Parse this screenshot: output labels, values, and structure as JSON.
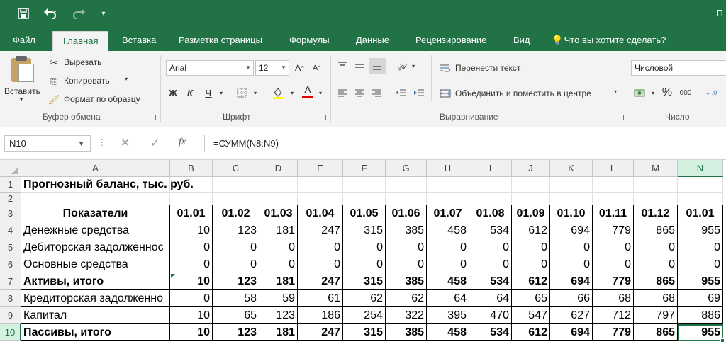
{
  "window": {
    "title_fragment": "П",
    "accent": "#217346"
  },
  "qat": {
    "save_icon": "save-icon",
    "undo_icon": "undo-icon",
    "redo_icon": "redo-icon",
    "customize_icon": "customize-qat-icon"
  },
  "tabs": [
    {
      "label": "Файл",
      "active": false
    },
    {
      "label": "Главная",
      "active": true
    },
    {
      "label": "Вставка",
      "active": false
    },
    {
      "label": "Разметка страницы",
      "active": false
    },
    {
      "label": "Формулы",
      "active": false
    },
    {
      "label": "Данные",
      "active": false
    },
    {
      "label": "Рецензирование",
      "active": false
    },
    {
      "label": "Вид",
      "active": false
    }
  ],
  "tell_me": {
    "label": "Что вы хотите сделать?",
    "icon": "lightbulb-icon"
  },
  "ribbon": {
    "clipboard": {
      "paste_label": "Вставить",
      "cut_label": "Вырезать",
      "copy_label": "Копировать",
      "format_painter_label": "Формат по образцу",
      "group_label": "Буфер обмена"
    },
    "font": {
      "font_name": "Arial",
      "font_size": "12",
      "bold": "Ж",
      "italic": "К",
      "underline": "Ч",
      "group_label": "Шрифт"
    },
    "alignment": {
      "wrap_text_label": "Перенести текст",
      "merge_label": "Объединить и поместить в центре",
      "group_label": "Выравнивание"
    },
    "number": {
      "format_value": "Числовой",
      "percent": "%",
      "thousands": "000",
      "group_label": "Число"
    }
  },
  "formula_bar": {
    "name_box": "N10",
    "formula": "=СУММ(N8:N9)",
    "fx": "fx",
    "cancel": "✕",
    "enter": "✓"
  },
  "sheet": {
    "columns": [
      "A",
      "B",
      "C",
      "D",
      "E",
      "F",
      "G",
      "H",
      "I",
      "J",
      "K",
      "L",
      "M",
      "N"
    ],
    "selected_column": "N",
    "selected_row": "10",
    "title": "Прогнозный баланс, тыс. руб.",
    "header_label": "Показатели",
    "dates": [
      "01.01",
      "01.02",
      "01.03",
      "01.04",
      "01.05",
      "01.06",
      "01.07",
      "01.08",
      "01.09",
      "01.10",
      "01.11",
      "01.12",
      "01.01"
    ],
    "rows": [
      {
        "num": "4",
        "label": "Денежные средства",
        "bold": false,
        "values": [
          "10",
          "123",
          "181",
          "247",
          "315",
          "385",
          "458",
          "534",
          "612",
          "694",
          "779",
          "865",
          "955"
        ]
      },
      {
        "num": "5",
        "label": "Дебиторская задолженнос",
        "bold": false,
        "values": [
          "0",
          "0",
          "0",
          "0",
          "0",
          "0",
          "0",
          "0",
          "0",
          "0",
          "0",
          "0",
          "0"
        ]
      },
      {
        "num": "6",
        "label": "Основные средства",
        "bold": false,
        "values": [
          "0",
          "0",
          "0",
          "0",
          "0",
          "0",
          "0",
          "0",
          "0",
          "0",
          "0",
          "0",
          "0"
        ]
      },
      {
        "num": "7",
        "label": "Активы, итого",
        "bold": true,
        "values": [
          "10",
          "123",
          "181",
          "247",
          "315",
          "385",
          "458",
          "534",
          "612",
          "694",
          "779",
          "865",
          "955"
        ]
      },
      {
        "num": "8",
        "label": "Кредиторская задолженно",
        "bold": false,
        "values": [
          "0",
          "58",
          "59",
          "61",
          "62",
          "62",
          "64",
          "64",
          "65",
          "66",
          "68",
          "68",
          "69"
        ]
      },
      {
        "num": "9",
        "label": "Капитал",
        "bold": false,
        "values": [
          "10",
          "65",
          "123",
          "186",
          "254",
          "322",
          "395",
          "470",
          "547",
          "627",
          "712",
          "797",
          "886"
        ]
      },
      {
        "num": "10",
        "label": "Пассивы, итого",
        "bold": true,
        "values": [
          "10",
          "123",
          "181",
          "247",
          "315",
          "385",
          "458",
          "534",
          "612",
          "694",
          "779",
          "865",
          "955"
        ]
      }
    ],
    "row_numbers": [
      "1",
      "2",
      "3",
      "4",
      "5",
      "6",
      "7",
      "8",
      "9",
      "10"
    ]
  }
}
